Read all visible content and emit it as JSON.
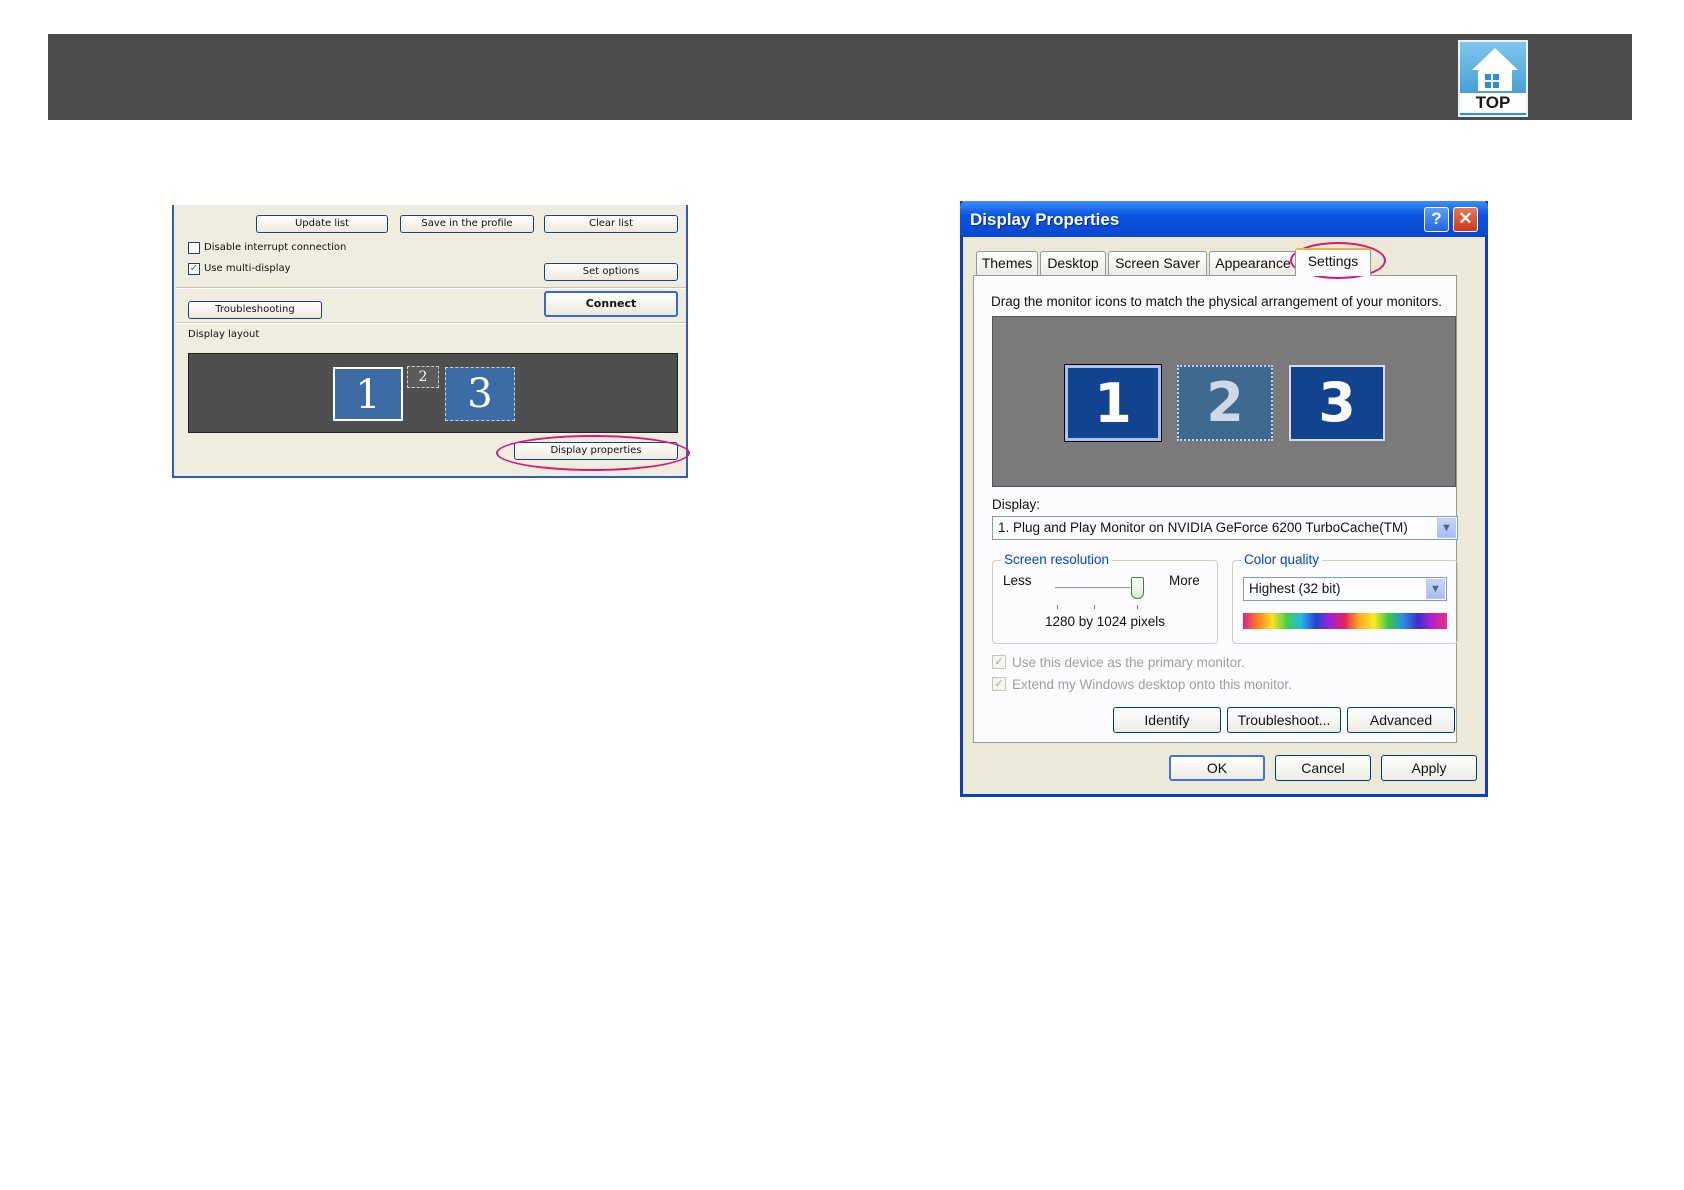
{
  "header": {
    "logo_text": "TOP"
  },
  "left_panel": {
    "buttons": {
      "update_list": "Update list",
      "save_profile": "Save in the profile",
      "clear_list": "Clear list",
      "set_options": "Set options",
      "troubleshooting": "Troubleshooting",
      "connect": "Connect",
      "display_properties": "Display properties"
    },
    "checkboxes": {
      "disable_interrupt": {
        "label": "Disable interrupt connection",
        "checked": false
      },
      "use_multi_display": {
        "label": "Use multi-display",
        "checked": true
      }
    },
    "display_layout_label": "Display layout",
    "monitors": [
      "1",
      "2",
      "3"
    ]
  },
  "dialog": {
    "title": "Display Properties",
    "help_glyph": "?",
    "close_glyph": "✕",
    "tabs": [
      "Themes",
      "Desktop",
      "Screen Saver",
      "Appearance",
      "Settings"
    ],
    "active_tab": "Settings",
    "instruction": "Drag the monitor icons to match the physical arrangement of your monitors.",
    "monitors": [
      "1",
      "2",
      "3"
    ],
    "display_label": "Display:",
    "display_value": "1. Plug and Play Monitor on NVIDIA GeForce 6200 TurboCache(TM)",
    "screen_resolution": {
      "title": "Screen resolution",
      "less": "Less",
      "more": "More",
      "value": "1280 by 1024 pixels",
      "level_fraction": 1.0
    },
    "color_quality": {
      "title": "Color quality",
      "value": "Highest (32 bit)"
    },
    "options": {
      "primary": "Use this device as the primary monitor.",
      "extend": "Extend my Windows desktop onto this monitor."
    },
    "buttons": {
      "identify": "Identify",
      "troubleshoot": "Troubleshoot...",
      "advanced": "Advanced",
      "ok": "OK",
      "cancel": "Cancel",
      "apply": "Apply"
    },
    "colors": {
      "title_bar": "#0a55e0",
      "highlight_oval": "#d8167a",
      "selected_monitor": "#11438f"
    }
  }
}
